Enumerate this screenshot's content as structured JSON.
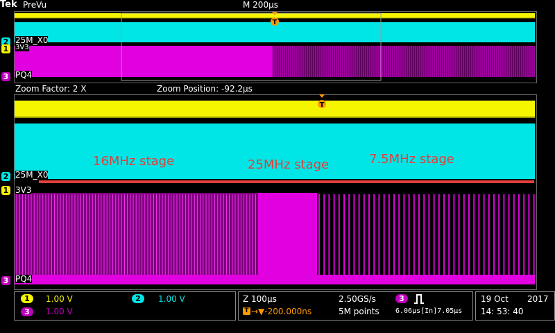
{
  "header": {
    "logo": "Tek",
    "mode": "PreVu",
    "timebase": "M 200µs",
    "zoom_factor": "Zoom Factor: 2 X",
    "zoom_position": "Zoom Position: -92.2µs"
  },
  "channels": {
    "ch1": {
      "num": "1",
      "label": "3V3",
      "scale": "1.00 V",
      "color": "#f5f500"
    },
    "ch2": {
      "num": "2",
      "label": "25M_X0",
      "scale": "1.00 V",
      "color": "#00e6e6"
    },
    "ch3": {
      "num": "3",
      "label": "PQ4",
      "scale": "1.00 V",
      "color": "#c000c0"
    }
  },
  "trigger_marker": "T",
  "annotations": {
    "stage_1": "16MHz stage",
    "stage_2": "25MHz stage",
    "stage_3": "7.5MHz stage"
  },
  "annotation_color": "#e0403c",
  "status": {
    "zoom_timebase": "Z 100µs",
    "trigger_position": "→▼-200.000ns",
    "sample_rate": "2.50GS/s",
    "record_length": "5M points",
    "trigger_channel": "3",
    "trigger_readout": "6.06µs[In]7.05µs",
    "date": "19 Oct",
    "year": "2017",
    "time": "14: 53: 40"
  }
}
